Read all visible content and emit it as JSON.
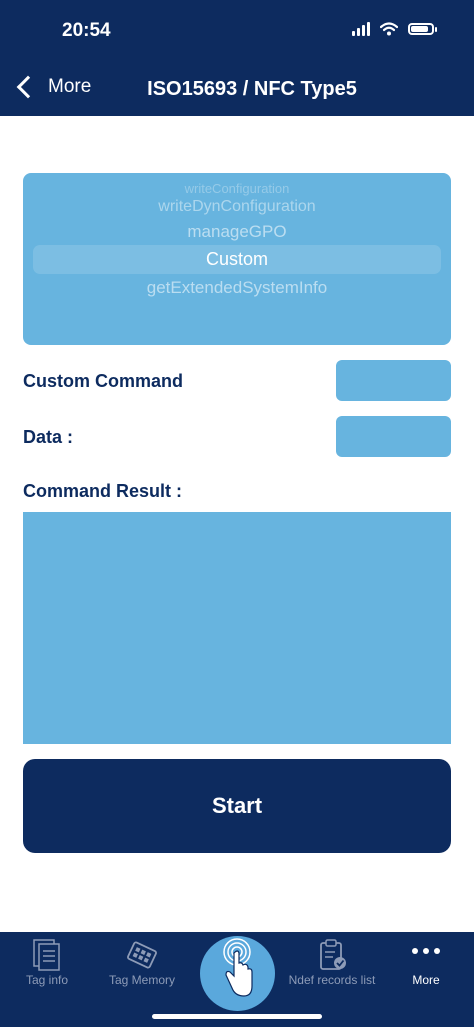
{
  "status": {
    "time": "20:54"
  },
  "nav": {
    "back_label": "More",
    "title": "ISO15693 / NFC Type5"
  },
  "picker": {
    "items": [
      "writeConfiguration",
      "writeDynConfiguration",
      "manageGPO",
      "Custom",
      "getExtendedSystemInfo"
    ],
    "selected": "Custom"
  },
  "form": {
    "custom_command_label": "Custom Command",
    "custom_command_value": "",
    "data_label": "Data :",
    "data_value": "",
    "result_label": "Command Result :",
    "result_value": ""
  },
  "start_button": "Start",
  "tabbar": {
    "tabs": [
      {
        "label": "Tag info",
        "icon": "document-icon"
      },
      {
        "label": "Tag Memory",
        "icon": "memory-chip-icon"
      },
      {
        "label": "",
        "icon": "nfc-touch-icon"
      },
      {
        "label": "Ndef records list",
        "icon": "clipboard-check-icon"
      },
      {
        "label": "More",
        "icon": "more-dots-icon"
      }
    ],
    "active": "More"
  },
  "colors": {
    "primary": "#0d2b5f",
    "accent": "#67b4df",
    "tab_inactive": "#8d9bb7"
  }
}
